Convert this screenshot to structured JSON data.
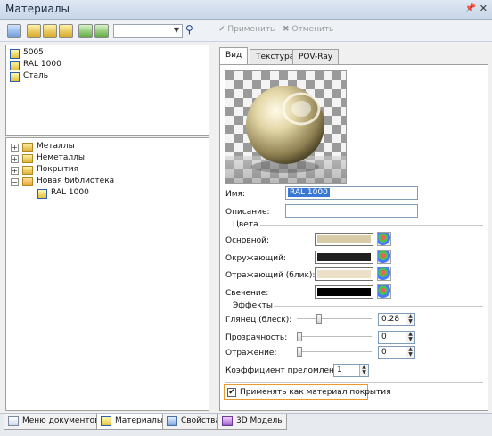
{
  "window": {
    "title": "Материалы"
  },
  "toolbar": {
    "search_value": "",
    "apply_label": "Применить",
    "cancel_label": "Отменить"
  },
  "materials_list": {
    "items": [
      {
        "label": "5005"
      },
      {
        "label": "RAL 1000"
      },
      {
        "label": "Сталь"
      }
    ]
  },
  "library_tree": {
    "items": [
      {
        "label": "Металлы"
      },
      {
        "label": "Неметаллы"
      },
      {
        "label": "Покрытия"
      },
      {
        "label": "Новая библиотека"
      },
      {
        "label": "RAL 1000"
      }
    ]
  },
  "tabs": [
    {
      "label": "Вид"
    },
    {
      "label": "Текстура"
    },
    {
      "label": "POV-Ray"
    }
  ],
  "properties": {
    "name_label": "Имя:",
    "name_value": "RAL 1000",
    "description_label": "Описание:",
    "description_value": "",
    "colors_group": "Цвета",
    "colors": [
      {
        "label": "Основной:",
        "color": "#d8cca8"
      },
      {
        "label": "Окружающий:",
        "color": "#202020"
      },
      {
        "label": "Отражающий (блик):",
        "color": "#ece1c8"
      },
      {
        "label": "Свечение:",
        "color": "#000000"
      }
    ],
    "effects_group": "Эффекты",
    "effects": [
      {
        "label": "Глянец (блеск):",
        "value": "0.28",
        "level": 0.28
      },
      {
        "label": "Прозрачность:",
        "value": "0",
        "level": 0
      },
      {
        "label": "Отражение:",
        "value": "0",
        "level": 0
      }
    ],
    "refraction_label": "Коэффициент преломления:",
    "refraction_value": "1",
    "apply_coating_label": "Применять как материал покрытия",
    "apply_coating_checked": true
  },
  "bottom_tabs": [
    {
      "label": "Меню документов"
    },
    {
      "label": "Материалы"
    },
    {
      "label": "Свойства"
    },
    {
      "label": "3D Модель"
    }
  ],
  "colors": {
    "accent_focus": "#e89a2c",
    "selection": "#3a78d6"
  }
}
